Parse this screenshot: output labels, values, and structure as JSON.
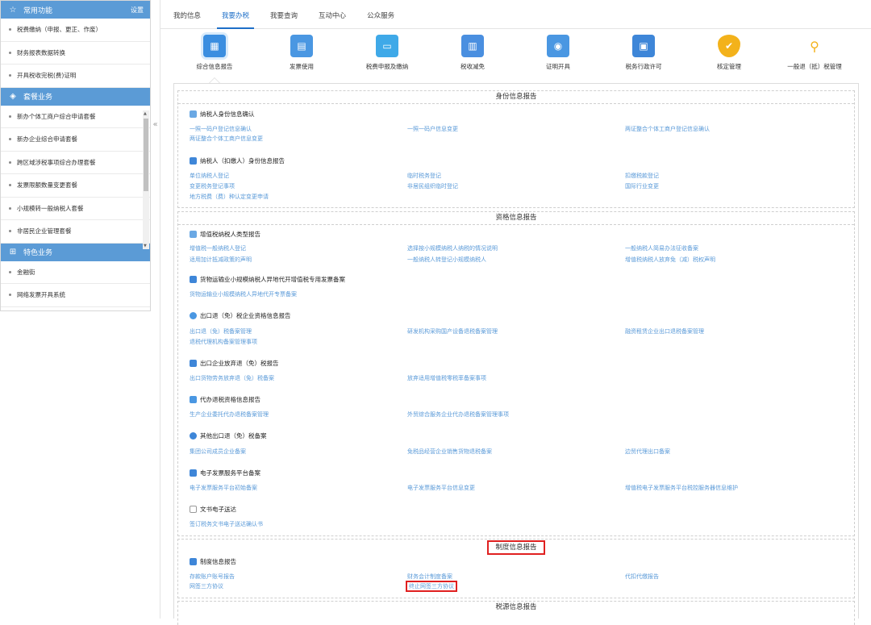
{
  "sidebar": {
    "common": {
      "title": "常用功能",
      "settings": "设置"
    },
    "common_items": [
      "税费缴纳（申报、更正、作废）",
      "财务报表数据转换",
      "开具税收完税(费)证明"
    ],
    "package": {
      "title": "套餐业务"
    },
    "package_items": [
      "新办个体工商户综合申请套餐",
      "新办企业综合申请套餐",
      "跨区域涉税事项综合办理套餐",
      "发票限额数量变更套餐",
      "小规模转一般纳税人套餐",
      "非居民企业管理套餐"
    ],
    "special": {
      "title": "特色业务"
    },
    "special_items": [
      "金融街",
      "网络发票开具系统"
    ]
  },
  "tabs": [
    "我的信息",
    "我要办税",
    "我要查询",
    "互动中心",
    "公众服务"
  ],
  "icons": [
    "综合信息报告",
    "发票使用",
    "税费申报及缴纳",
    "税收减免",
    "证明开具",
    "税务行政许可",
    "核定管理",
    "一般退（抵）税管理"
  ],
  "sections": {
    "identity": {
      "title": "身份信息报告",
      "g1": "纳税人身份信息确认",
      "g1_links": [
        "一照一码户登记信息确认",
        "一照一码户信息变更",
        "两证整合个体工商户登记信息确认",
        "两证整合个体工商户信息变更"
      ],
      "g2": "纳税人（扣缴人）身份信息报告",
      "g2_links": [
        "单位纳税人登记",
        "临时税务登记",
        "扣缴税款登记",
        "变更税务登记事项",
        "非居民组织临时登记",
        "国际行业变更",
        "地方税费（费）种认定变更申请"
      ]
    },
    "qualification": {
      "title": "资格信息报告",
      "g1": "增值税纳税人类型报告",
      "g1_links": [
        "增值税一般纳税人登记",
        "选择按小规模纳税人纳税的情况说明",
        "一般纳税人简易办法征收备案",
        "适用加计抵减政策的声明",
        "一般纳税人转登记小规模纳税人",
        "增值税纳税人放弃免（减）税权声明"
      ],
      "g2": "货物运输业小规模纳税人异地代开增值税专用发票备案",
      "g2_links": [
        "货物运输业小规模纳税人异地代开专票备案"
      ],
      "g3": "出口退（免）税企业资格信息报告",
      "g3_links": [
        "出口退（免）税备案管理",
        "研发机构采购国产设备退税备案管理",
        "融资租赁企业出口退税备案管理",
        "退税代理机构备案管理事项"
      ],
      "g4": "出口企业放弃退（免）税报告",
      "g4_links": [
        "出口货物劳务放弃退（免）税备案",
        "放弃适用增值税零税率备案事项"
      ],
      "g5": "代办退税资格信息报告",
      "g5_links": [
        "生产企业委托代办退税备案管理",
        "外贸综合服务企业代办退税备案管理事项"
      ],
      "g6": "其他出口退（免）税备案",
      "g6_links": [
        "集团公司成员企业备案",
        "免税品经营企业销售货物退税备案",
        "边贸代理出口备案"
      ],
      "g7": "电子发票服务平台备案",
      "g7_links": [
        "电子发票服务平台初始备案",
        "电子发票服务平台信息变更",
        "增值税电子发票服务平台税控服务器信息维护"
      ],
      "g8": "文书电子送达",
      "g8_links": [
        "签订税务文书电子送达确认书"
      ]
    },
    "system": {
      "title": "制度信息报告",
      "g1": "制度信息报告",
      "g1_links": [
        "存款账户账号报告",
        "财务会计制度备案",
        "代扣代缴报告",
        "网签三方协议",
        "终止网签三方协议"
      ]
    },
    "tax_source": {
      "title": "税源信息报告"
    }
  },
  "colors": {
    "sidebar_header": "#5b9bd6",
    "link": "#5a9ad8",
    "active_tab": "#1e6fc8",
    "highlight": "#e02020"
  }
}
